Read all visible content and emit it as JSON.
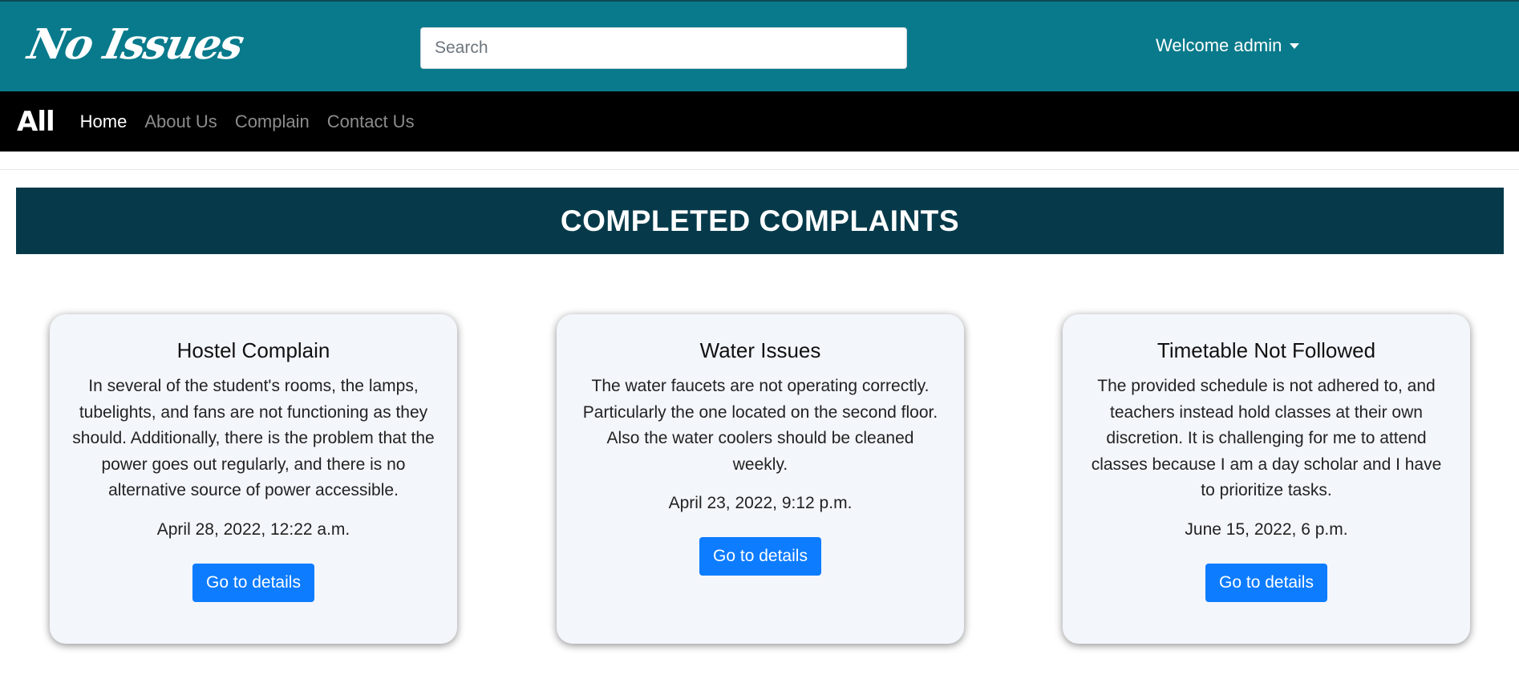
{
  "header": {
    "logo_text": "No Issues",
    "search_placeholder": "Search",
    "welcome_label": "Welcome admin"
  },
  "navbar": {
    "brand": "All",
    "links": [
      {
        "label": "Home",
        "active": true
      },
      {
        "label": "About Us",
        "active": false
      },
      {
        "label": "Complain",
        "active": false
      },
      {
        "label": "Contact Us",
        "active": false
      }
    ]
  },
  "banner": {
    "title": "COMPLETED COMPLAINTS"
  },
  "cards": [
    {
      "title": "Hostel Complain",
      "description": "In several of the student's rooms, the lamps, tubelights, and fans are not functioning as they should. Additionally, there is the problem that the power goes out regularly, and there is no alternative source of power accessible.",
      "date": "April 28, 2022, 12:22 a.m.",
      "button_label": "Go to details"
    },
    {
      "title": "Water Issues",
      "description": "The water faucets are not operating correctly. Particularly the one located on the second floor. Also the water coolers should be cleaned weekly.",
      "date": "April 23, 2022, 9:12 p.m.",
      "button_label": "Go to details"
    },
    {
      "title": "Timetable Not Followed",
      "description": "The provided schedule is not adhered to, and teachers instead hold classes at their own discretion. It is challenging for me to attend classes because I am a day scholar and I have to prioritize tasks.",
      "date": "June 15, 2022, 6 p.m.",
      "button_label": "Go to details"
    }
  ],
  "colors": {
    "header_bg": "#087a8b",
    "navbar_bg": "#000000",
    "banner_bg": "#063a4a",
    "card_bg": "#f3f6fb",
    "button_bg": "#0d7cff"
  }
}
